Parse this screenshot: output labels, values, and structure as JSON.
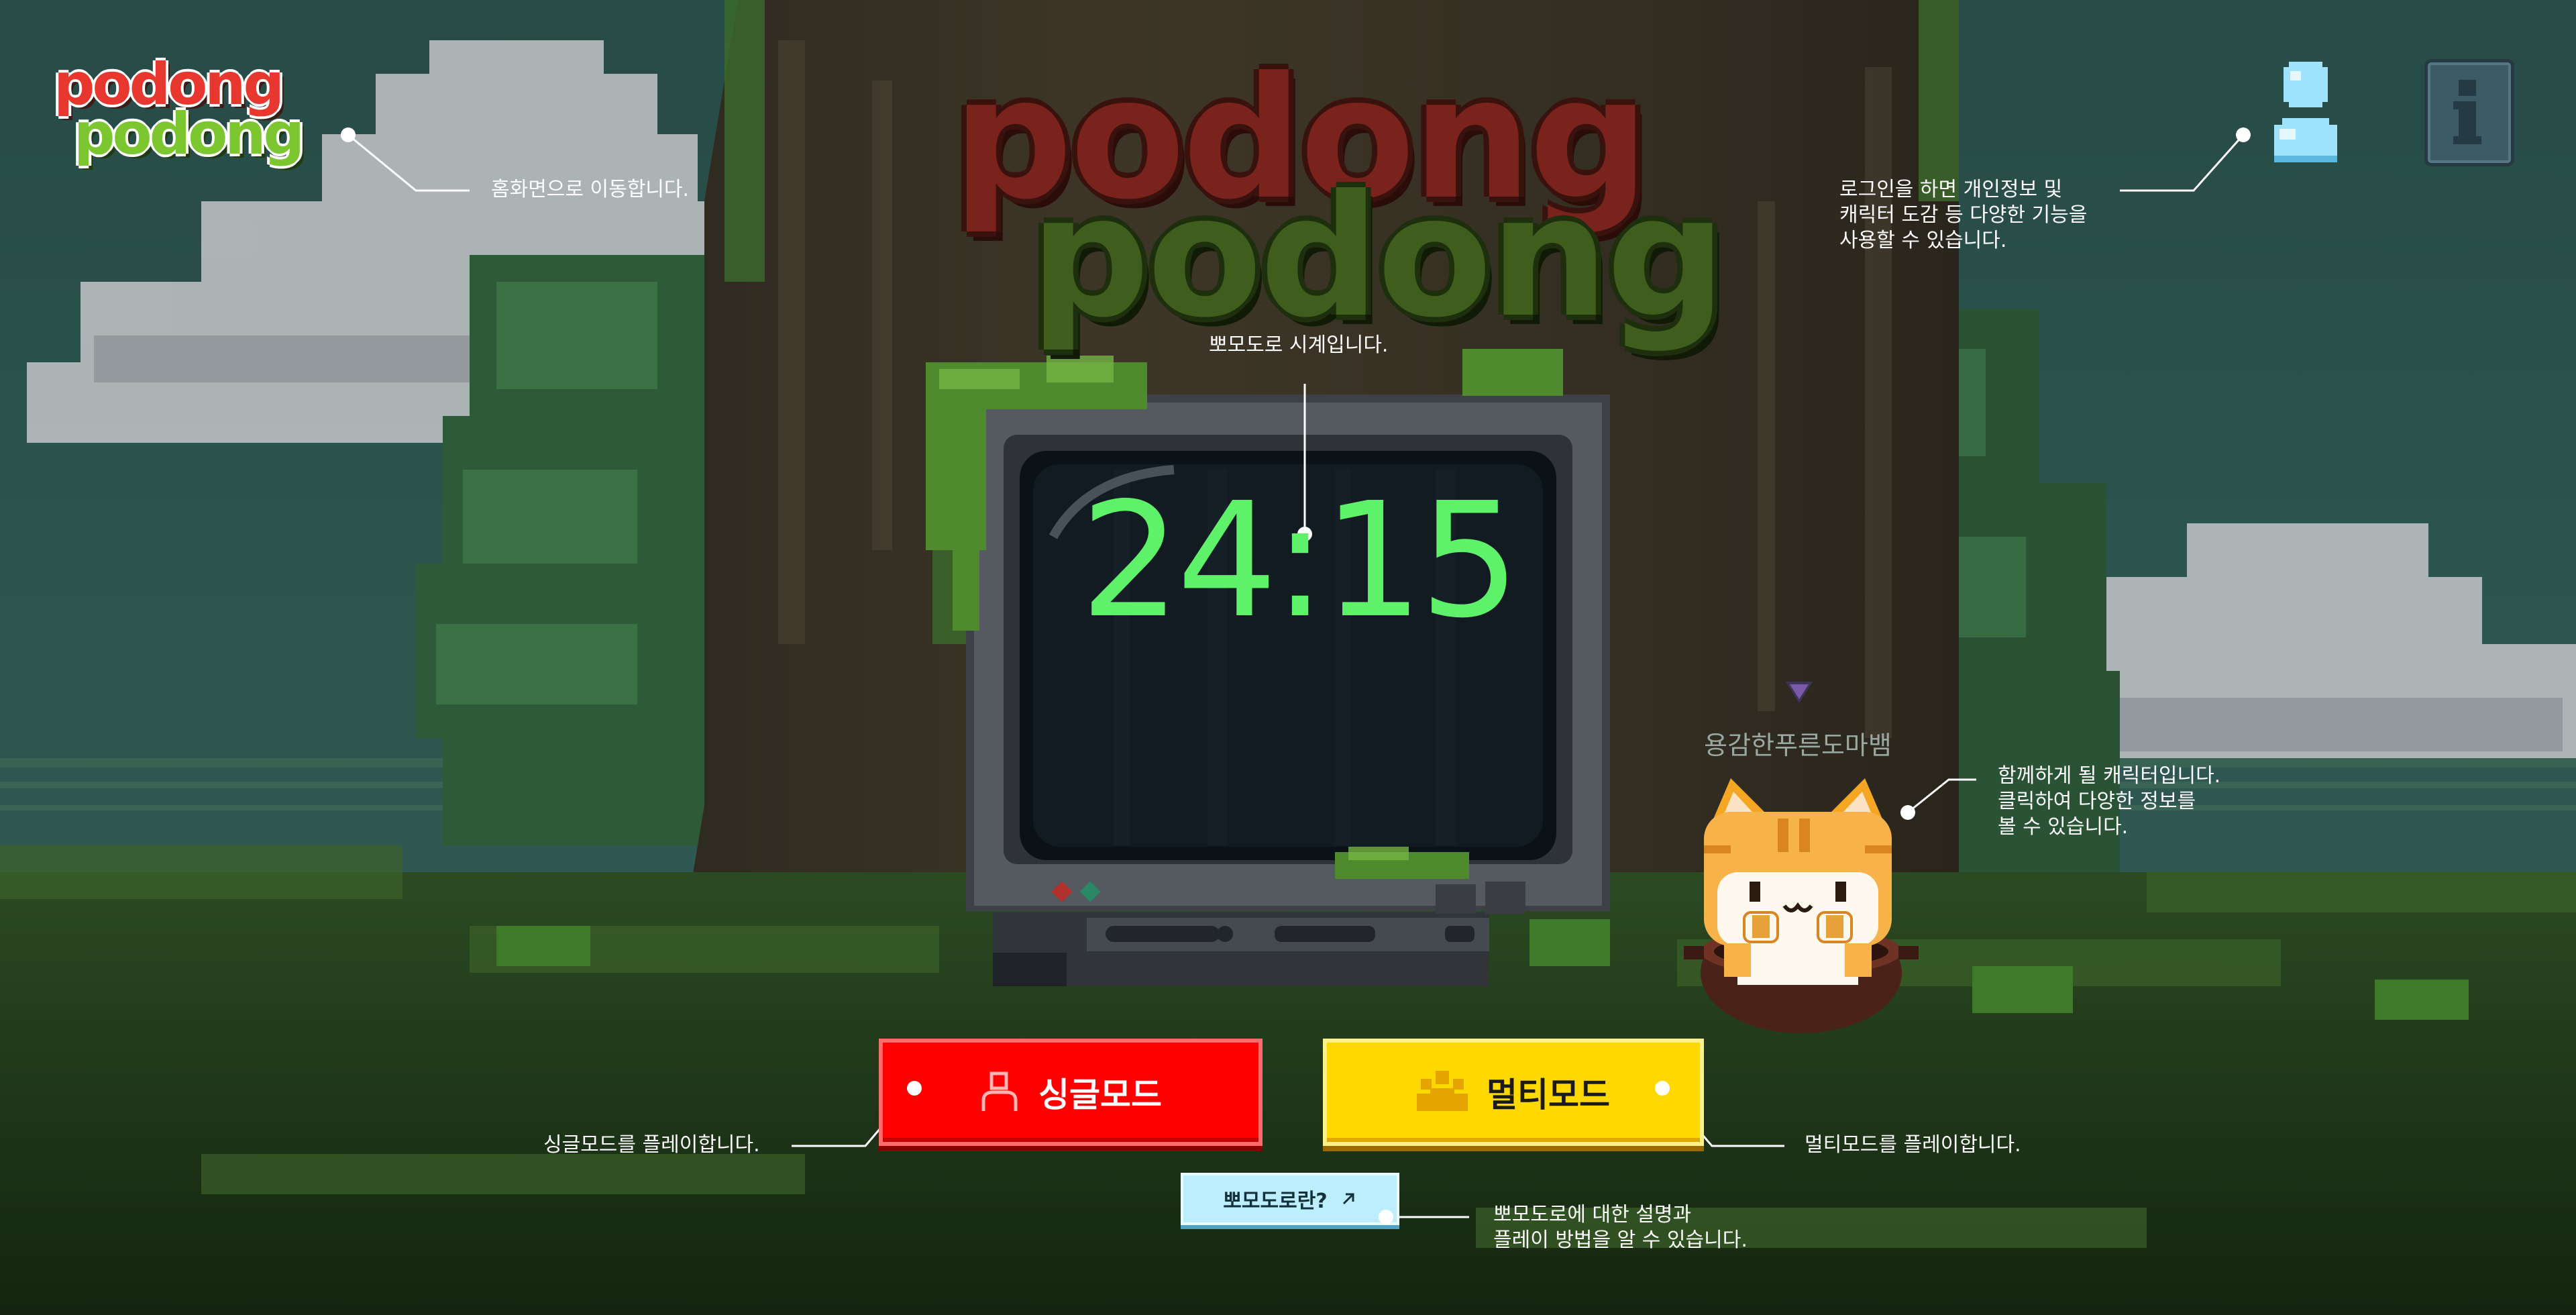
{
  "logo": {
    "line1": "podong",
    "line2": "podong"
  },
  "title_logo": {
    "line1": "podong",
    "line2": "podong"
  },
  "clock": {
    "time": "24:15"
  },
  "buttons": {
    "single": "싱글모드",
    "multi": "멀티모드",
    "about": "뽀모도로란?"
  },
  "character": {
    "name": "용감한푸른도마뱀"
  },
  "annotations": {
    "home": "홈화면으로 이동합니다.",
    "login": "로그인을 하면 개인정보 및\n캐릭터 도감 등 다양한 기능을\n사용할 수 있습니다.",
    "clock": "뽀모도로 시계입니다.",
    "character": "함께하게 될 캐릭터입니다.\n클릭하여 다양한 정보를\n볼 수 있습니다.",
    "single": "싱글모드를 플레이합니다.",
    "multi": "멀티모드를 플레이합니다.",
    "about": "뽀모도로에 대한 설명과\n플레이 방법을 알 수 있습니다."
  },
  "icons": {
    "user": "user-icon",
    "info": "info-icon",
    "single": "single-person-icon",
    "multi": "group-icon",
    "external": "arrow-up-right-icon"
  },
  "colors": {
    "single_button": "#ff0000",
    "multi_button": "#ffd800",
    "about_button": "#bdeefd",
    "clock_text": "#5ef16a",
    "user_icon": "#9fe3ff",
    "logo_red": "#e8372f",
    "logo_green": "#7cc62f"
  }
}
